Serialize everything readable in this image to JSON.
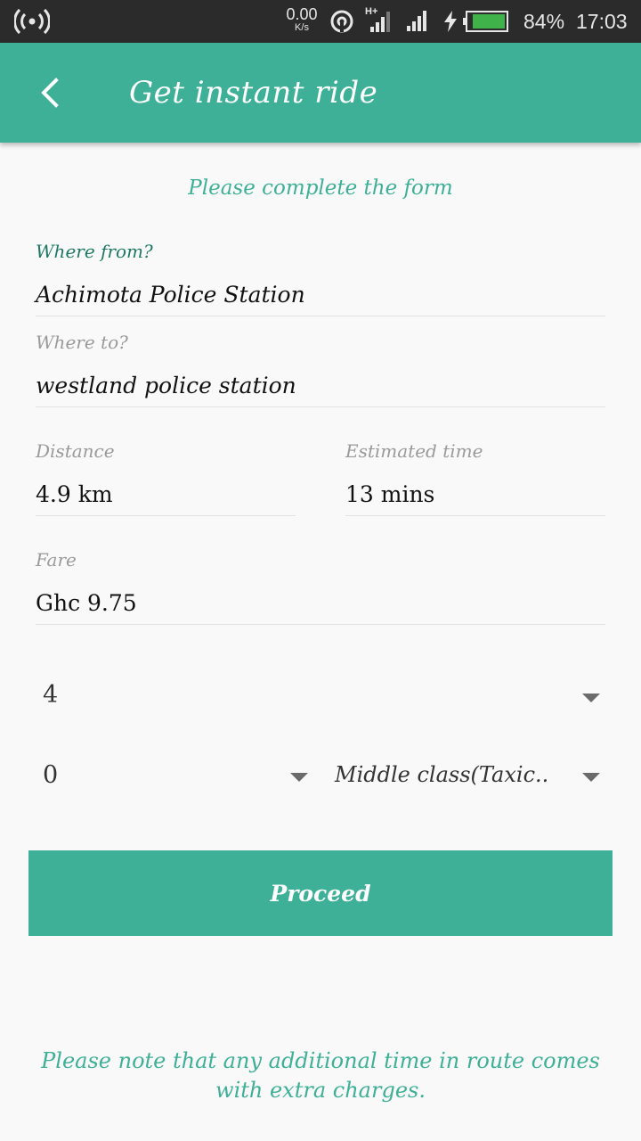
{
  "status_bar": {
    "speed_value": "0.00",
    "speed_unit": "K/s",
    "network_type": "H+",
    "battery_percent": "84%",
    "time": "17:03",
    "icons": [
      "hotspot-icon",
      "nfc-icon",
      "signal-icon",
      "charging-icon",
      "battery-icon"
    ]
  },
  "app_bar": {
    "title": "Get instant ride",
    "back_icon": "back-arrow-icon"
  },
  "form": {
    "subtitle": "Please complete the form",
    "from_label": "Where from?",
    "from_value": "Achimota Police Station",
    "to_label": "Where to?",
    "to_value": "westland police station",
    "distance_label": "Distance",
    "distance_value": "4.9 km",
    "time_label": "Estimated time",
    "time_value": "13 mins",
    "fare_label": "Fare",
    "fare_value": "Ghc 9.75",
    "spinner1_value": "4",
    "spinner2_value": "0",
    "spinner3_value": "Middle class(Taxic.."
  },
  "proceed_label": "Proceed",
  "note": "Please note that any additional time in route comes with extra charges.",
  "colors": {
    "accent": "#3eb097",
    "status_bar": "#2b2b2b",
    "label_active": "#1f7a63",
    "battery_fill": "#3fb24a"
  }
}
